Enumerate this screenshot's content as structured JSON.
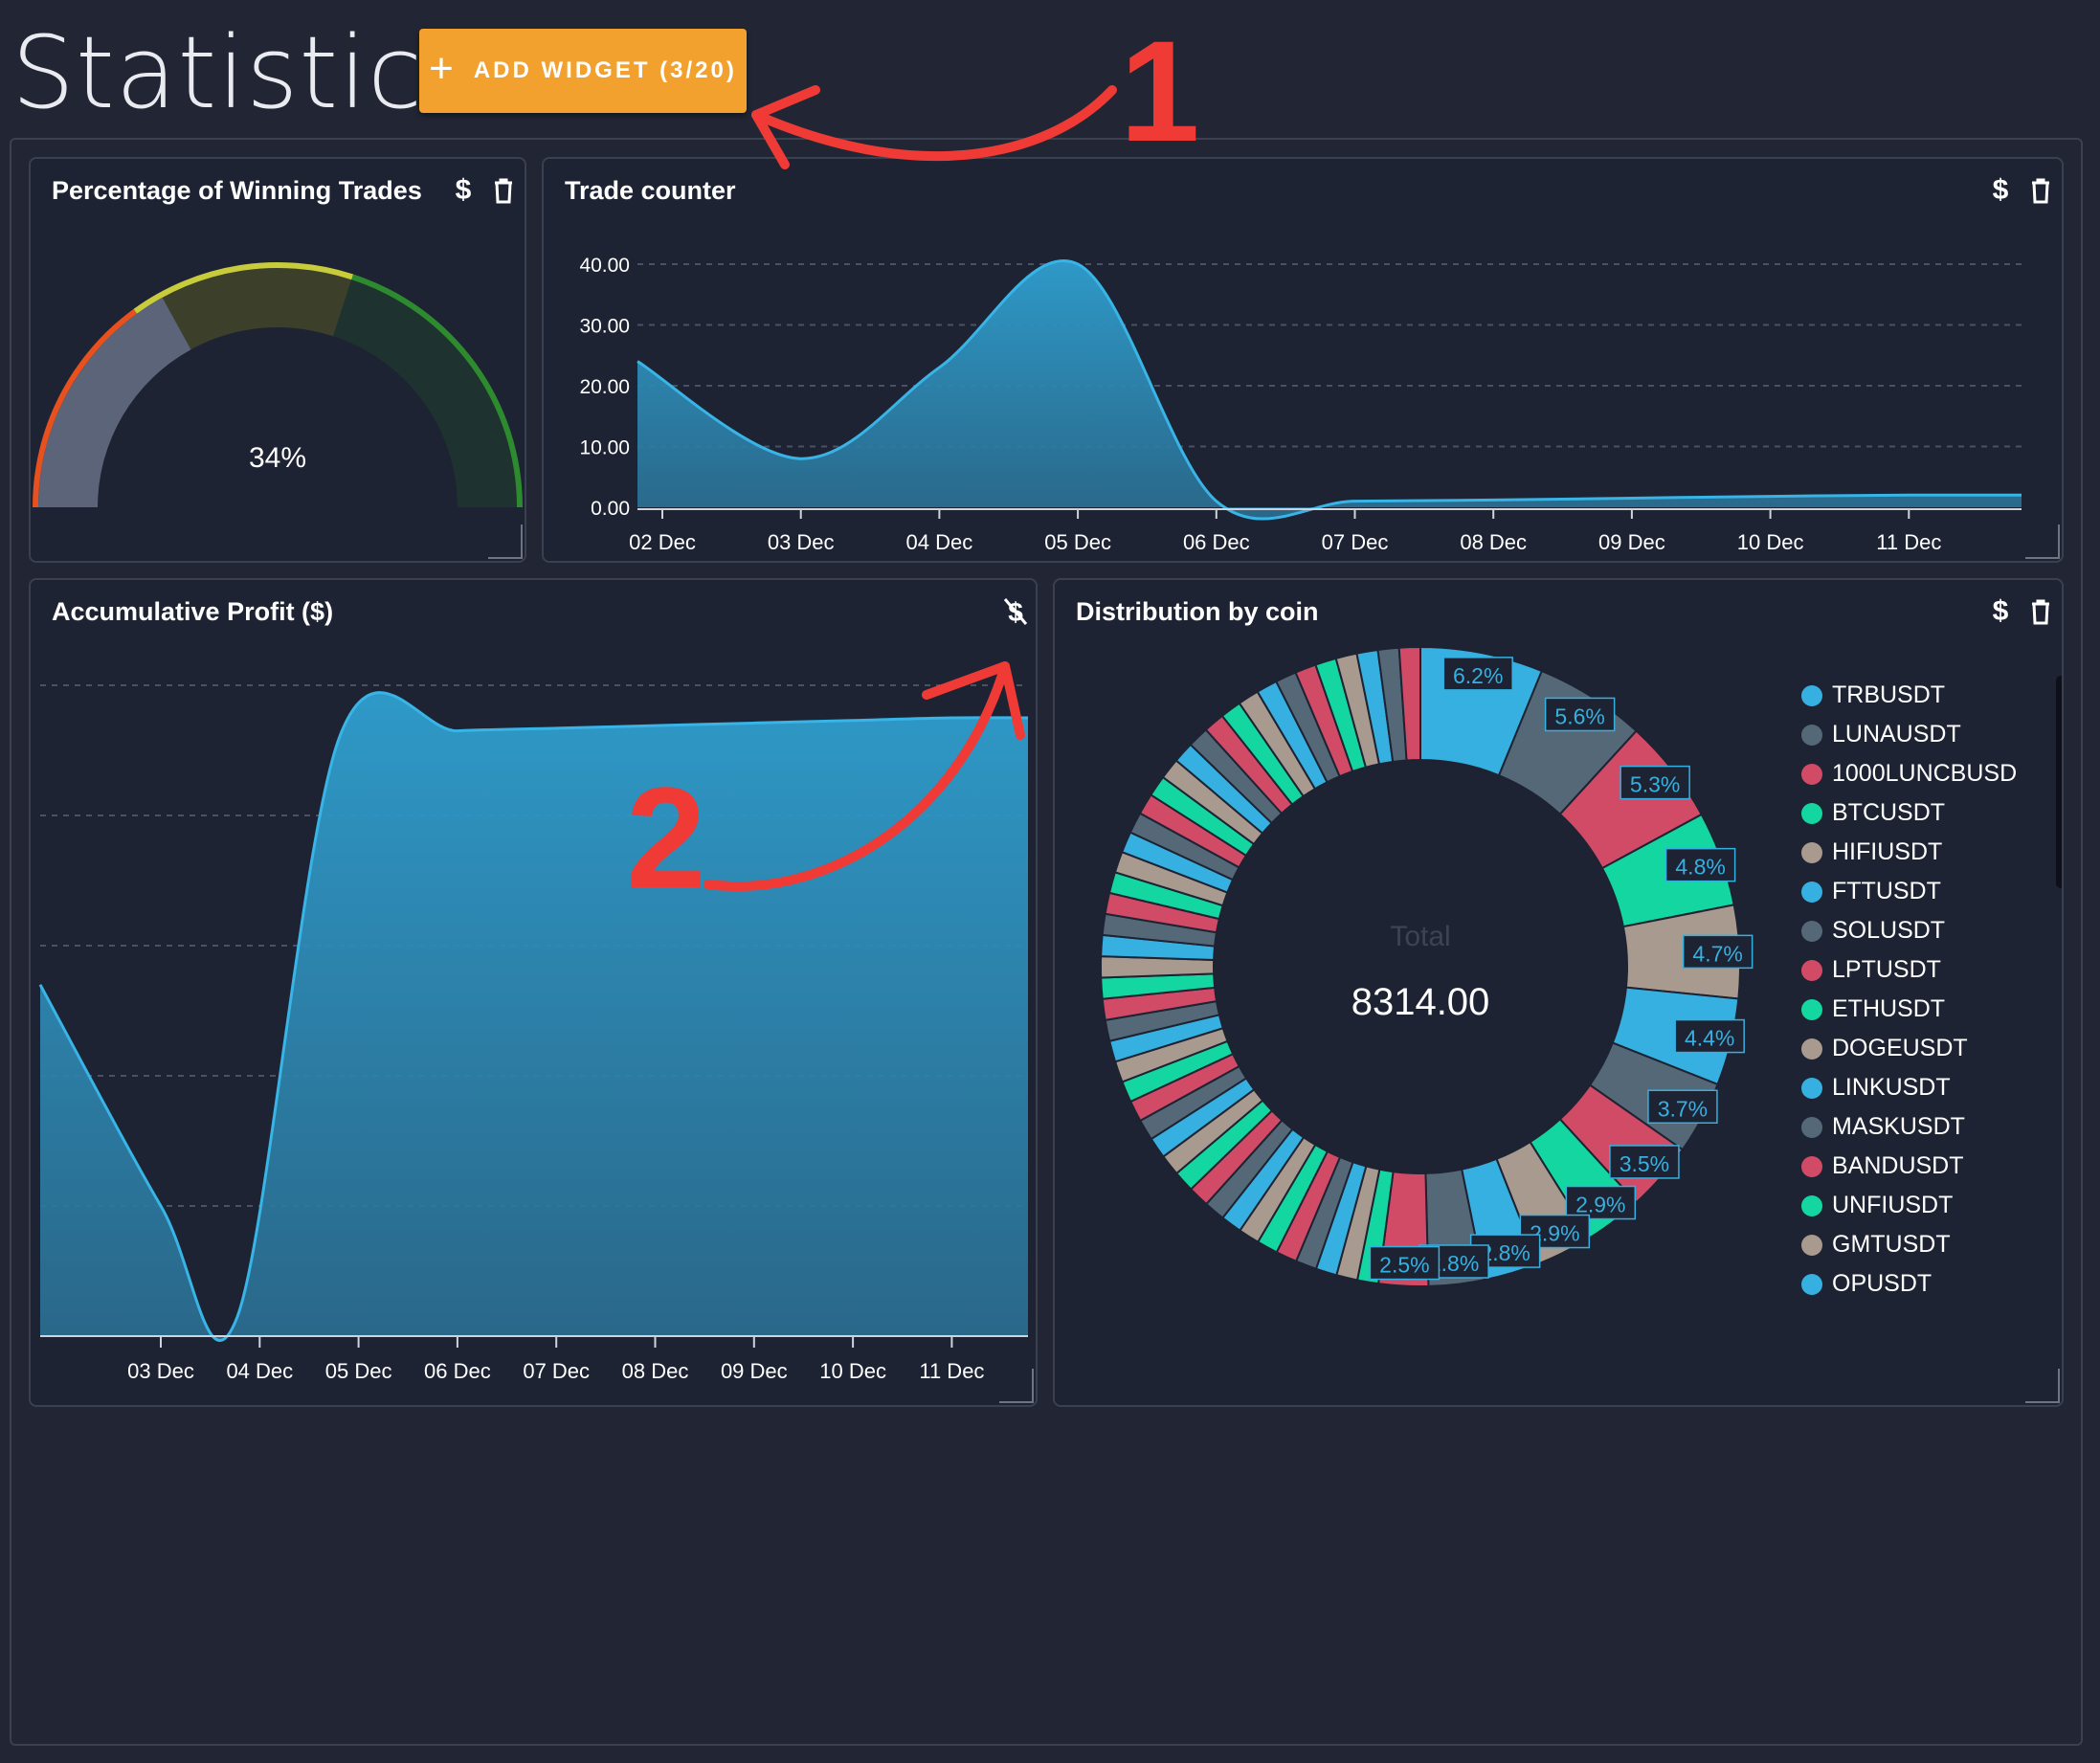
{
  "page": {
    "title": "Statistics"
  },
  "toolbar": {
    "add_widget_label": "ADD WIDGET (3/20)",
    "add_icon": "plus-icon"
  },
  "widgets": {
    "winning": {
      "title": "Percentage of Winning Trades",
      "value_label": "34%",
      "value": 34,
      "icons": [
        "dollar-icon",
        "trash-icon"
      ]
    },
    "trade_counter": {
      "title": "Trade counter",
      "icons": [
        "dollar-icon",
        "trash-icon"
      ]
    },
    "profit": {
      "title": "Accumulative Profit ($)",
      "icons": [
        "dollar-off-icon"
      ]
    },
    "distribution": {
      "title": "Distribution by coin",
      "center_label": "Total",
      "center_value": "8314.00",
      "icons": [
        "dollar-icon",
        "trash-icon"
      ],
      "legend": [
        {
          "name": "TRBUSDT",
          "color": "#35b0e0"
        },
        {
          "name": "LUNAUSDT",
          "color": "#556877"
        },
        {
          "name": "1000LUNCBUSD",
          "color": "#d14b67"
        },
        {
          "name": "BTCUSDT",
          "color": "#14d6a0"
        },
        {
          "name": "HIFIUSDT",
          "color": "#a89a8e"
        },
        {
          "name": "FTTUSDT",
          "color": "#35b0e0"
        },
        {
          "name": "SOLUSDT",
          "color": "#556877"
        },
        {
          "name": "LPTUSDT",
          "color": "#d14b67"
        },
        {
          "name": "ETHUSDT",
          "color": "#14d6a0"
        },
        {
          "name": "DOGEUSDT",
          "color": "#a89a8e"
        },
        {
          "name": "LINKUSDT",
          "color": "#35b0e0"
        },
        {
          "name": "MASKUSDT",
          "color": "#556877"
        },
        {
          "name": "BANDUSDT",
          "color": "#d14b67"
        },
        {
          "name": "UNFIUSDT",
          "color": "#14d6a0"
        },
        {
          "name": "GMTUSDT",
          "color": "#a89a8e"
        },
        {
          "name": "OPUSDT",
          "color": "#35b0e0"
        }
      ]
    }
  },
  "annotations": {
    "one": "1",
    "two": "2"
  },
  "chart_data": [
    {
      "id": "winning-gauge",
      "type": "gauge",
      "title": "Percentage of Winning Trades",
      "value": 34,
      "range": [
        0,
        100
      ],
      "bands": [
        {
          "to": 30,
          "color": "#e8501e"
        },
        {
          "to": 60,
          "color": "#c8cc3a"
        },
        {
          "to": 100,
          "color": "#2e8a2e"
        }
      ]
    },
    {
      "id": "trade-counter",
      "type": "area",
      "title": "Trade counter",
      "x": [
        "02 Dec",
        "03 Dec",
        "04 Dec",
        "05 Dec",
        "06 Dec",
        "07 Dec",
        "08 Dec",
        "09 Dec",
        "10 Dec",
        "11 Dec"
      ],
      "values": [
        24,
        8,
        23,
        40,
        1,
        1,
        1.2,
        1.5,
        1.8,
        2
      ],
      "yticks": [
        "0.00",
        "10.00",
        "20.00",
        "30.00",
        "40.00"
      ],
      "ylim": [
        0,
        40
      ],
      "grid": true
    },
    {
      "id": "accumulative-profit",
      "type": "area",
      "title": "Accumulative Profit ($)",
      "x": [
        "03 Dec",
        "04 Dec",
        "05 Dec",
        "06 Dec",
        "07 Dec",
        "08 Dec",
        "09 Dec",
        "10 Dec",
        "11 Dec"
      ],
      "values": [
        -27,
        -35,
        9,
        9.5,
        9.7,
        9.9,
        10.1,
        10.3,
        10.5
      ],
      "grid": true
    },
    {
      "id": "distribution-by-coin",
      "type": "pie",
      "title": "Distribution by coin",
      "total": 8314.0,
      "labeled_slices": [
        6.2,
        5.6,
        5.3,
        4.8,
        4.7,
        4.4,
        3.7,
        3.5,
        2.9,
        2.9,
        2.8,
        2.8,
        2.5
      ],
      "other_slice_count": 45,
      "palette": [
        "#35b0e0",
        "#556877",
        "#d14b67",
        "#14d6a0",
        "#a89a8e"
      ]
    }
  ]
}
